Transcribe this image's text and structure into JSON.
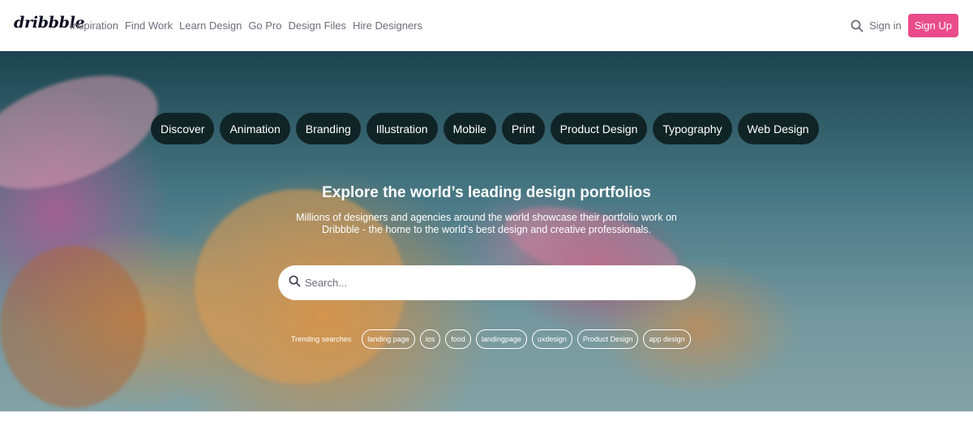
{
  "nav": {
    "logo": "dribbble",
    "links": [
      "Inspiration",
      "Find Work",
      "Learn Design",
      "Go Pro",
      "Design Files",
      "Hire Designers"
    ],
    "search_icon": "search-icon",
    "signin": "Sign in",
    "signup": "Sign Up",
    "signup_color": "#ea4c89"
  },
  "hero": {
    "categories": [
      "Discover",
      "Animation",
      "Branding",
      "Illustration",
      "Mobile",
      "Print",
      "Product Design",
      "Typography",
      "Web Design"
    ],
    "headline": "Explore the world’s leading design portfolios",
    "subline": "Millions of designers and agencies around the world showcase their portfolio work on Dribbble - the home to the world's best design and creative professionals.",
    "search": {
      "placeholder": "Search...",
      "icon": "search-icon"
    },
    "trending_label": "Trending searches",
    "trending_tags": [
      "landing page",
      "ios",
      "food",
      "landingpage",
      "uxdesign",
      "Product Design",
      "app design"
    ]
  }
}
